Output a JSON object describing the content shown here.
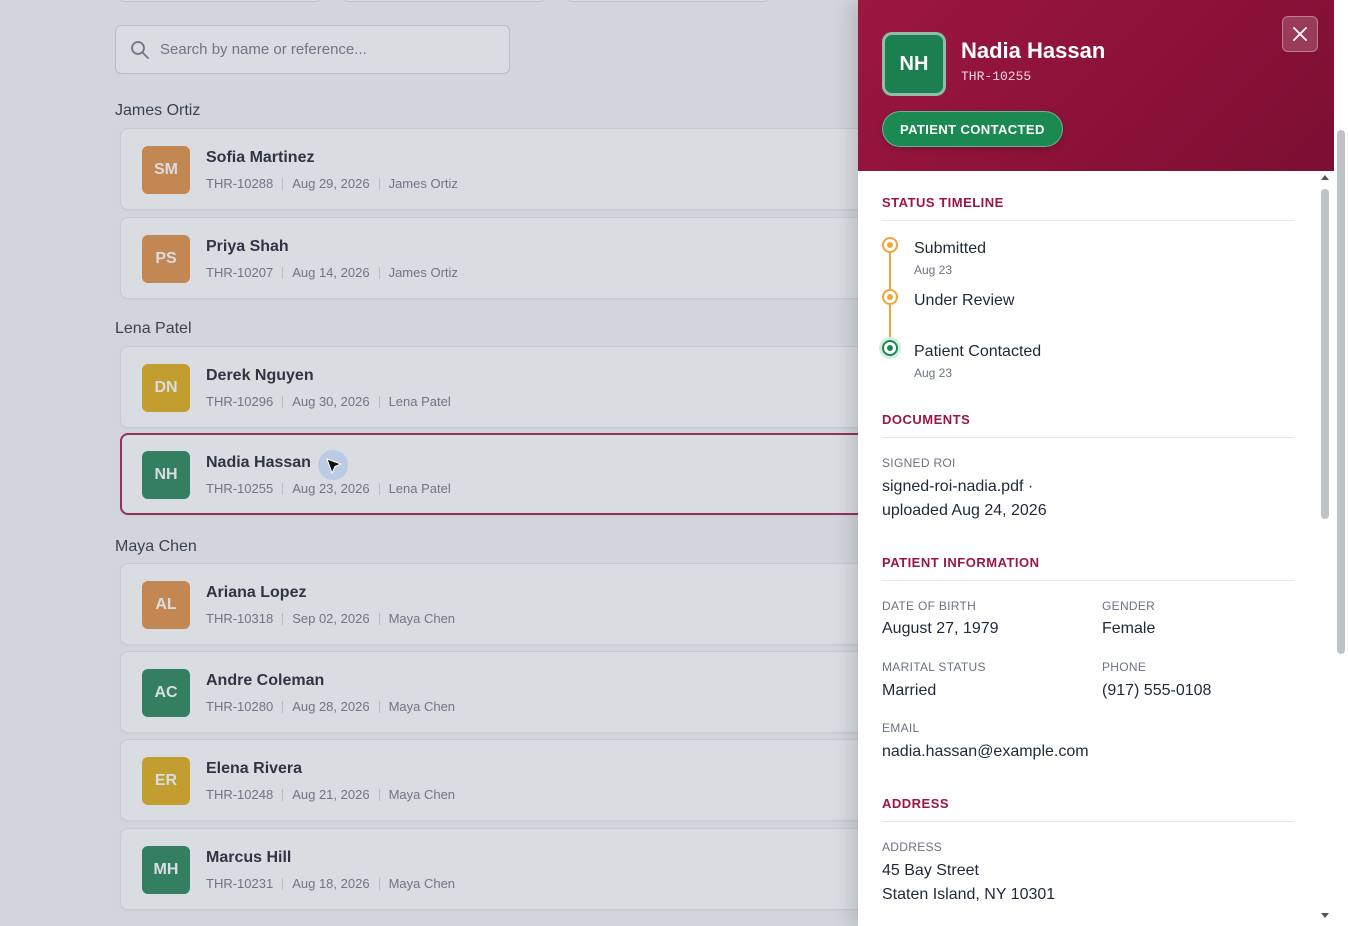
{
  "search": {
    "placeholder": "Search by name or reference..."
  },
  "groups": [
    {
      "title": "James Ortiz",
      "rows": [
        {
          "initials": "SM",
          "name": "Sofia Martinez",
          "ref": "THR-10288",
          "date": "Aug 29, 2026",
          "owner": "James Ortiz",
          "color": "#e08a3c"
        },
        {
          "initials": "PS",
          "name": "Priya Shah",
          "ref": "THR-10207",
          "date": "Aug 14, 2026",
          "owner": "James Ortiz",
          "color": "#e08a3c"
        }
      ]
    },
    {
      "title": "Lena Patel",
      "rows": [
        {
          "initials": "DN",
          "name": "Derek Nguyen",
          "ref": "THR-10296",
          "date": "Aug 30, 2026",
          "owner": "Lena Patel",
          "color": "#e0a80c"
        },
        {
          "initials": "NH",
          "name": "Nadia Hassan",
          "ref": "THR-10255",
          "date": "Aug 23, 2026",
          "owner": "Lena Patel",
          "color": "#1b7f4f"
        }
      ]
    },
    {
      "title": "Maya Chen",
      "rows": [
        {
          "initials": "AL",
          "name": "Ariana Lopez",
          "ref": "THR-10318",
          "date": "Sep 02, 2026",
          "owner": "Maya Chen",
          "color": "#e08a3c"
        },
        {
          "initials": "AC",
          "name": "Andre Coleman",
          "ref": "THR-10280",
          "date": "Aug 28, 2026",
          "owner": "Maya Chen",
          "color": "#1b7f4f"
        },
        {
          "initials": "ER",
          "name": "Elena Rivera",
          "ref": "THR-10248",
          "date": "Aug 21, 2026",
          "owner": "Maya Chen",
          "color": "#e0a80c"
        },
        {
          "initials": "MH",
          "name": "Marcus Hill",
          "ref": "THR-10231",
          "date": "Aug 18, 2026",
          "owner": "Maya Chen",
          "color": "#1b7f4f"
        }
      ]
    }
  ],
  "drawer": {
    "initials": "NH",
    "name": "Nadia Hassan",
    "ref": "THR-10255",
    "status": "PATIENT CONTACTED",
    "accent": "#9b1741",
    "status_color": "#1b8a52",
    "timeline_title": "STATUS TIMELINE",
    "timeline": [
      {
        "label": "Submitted",
        "date": "Aug 23"
      },
      {
        "label": "Under Review",
        "date": ""
      },
      {
        "label": "Patient Contacted",
        "date": "Aug 23"
      }
    ],
    "documents_title": "DOCUMENTS",
    "signed_roi_label": "SIGNED ROI",
    "signed_roi_line1": "signed-roi-nadia.pdf ·",
    "signed_roi_line2": "uploaded Aug 24, 2026",
    "patient_info_title": "PATIENT INFORMATION",
    "dob_label": "DATE OF BIRTH",
    "dob": "August 27, 1979",
    "gender_label": "GENDER",
    "gender": "Female",
    "marital_label": "MARITAL STATUS",
    "marital": "Married",
    "phone_label": "PHONE",
    "phone": "(917) 555-0108",
    "email_label": "EMAIL",
    "email": "nadia.hassan@example.com",
    "address_title": "ADDRESS",
    "address_label": "ADDRESS",
    "address_line1": "45 Bay Street",
    "address_line2": "Staten Island, NY 10301"
  }
}
